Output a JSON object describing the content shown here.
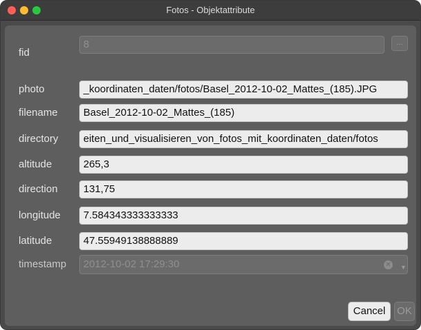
{
  "window": {
    "title": "Fotos - Objektattribute"
  },
  "fields": {
    "fid": {
      "label": "fid",
      "value": "8"
    },
    "photo": {
      "label": "photo",
      "value": "_koordinaten_daten/fotos/Basel_2012-10-02_Mattes_(185).JPG"
    },
    "filename": {
      "label": "filename",
      "value": "Basel_2012-10-02_Mattes_(185)"
    },
    "directory": {
      "label": "directory",
      "value": "eiten_und_visualisieren_von_fotos_mit_koordinaten_daten/fotos"
    },
    "altitude": {
      "label": "altitude",
      "value": "265,3"
    },
    "direction": {
      "label": "direction",
      "value": "131,75"
    },
    "longitude": {
      "label": "longitude",
      "value": "7.584343333333333"
    },
    "latitude": {
      "label": "latitude",
      "value": "47.55949138888889"
    },
    "timestamp": {
      "label": "timestamp",
      "value": "2012-10-02 17:29:30"
    }
  },
  "buttons": {
    "more": "...",
    "cancel": "Cancel",
    "ok": "OK"
  },
  "icons": {
    "clear": "clear-icon",
    "dropdown": "chevron-down-icon"
  },
  "colors": {
    "close": "#fe5f57",
    "minimize": "#febc2e",
    "maximize": "#28c840"
  }
}
